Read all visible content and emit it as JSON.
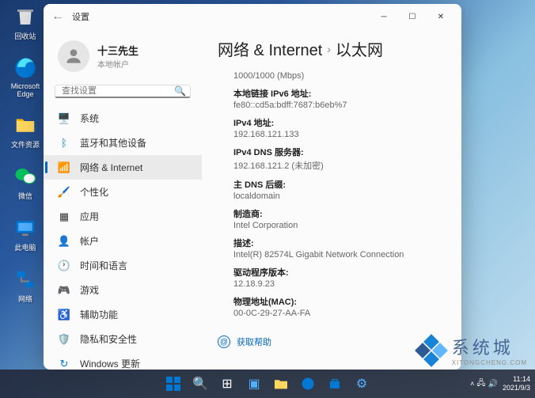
{
  "desktop": {
    "icons": [
      {
        "label": "回收站"
      },
      {
        "label": "Microsoft Edge"
      },
      {
        "label": "文件资源"
      },
      {
        "label": "微信"
      },
      {
        "label": "此电脑"
      },
      {
        "label": "网络"
      }
    ]
  },
  "window": {
    "title": "设置",
    "user": {
      "name": "十三先生",
      "sub": "本地帐户"
    },
    "search_placeholder": "查找设置",
    "nav": [
      {
        "icon": "system",
        "label": "系统"
      },
      {
        "icon": "bluetooth",
        "label": "蓝牙和其他设备"
      },
      {
        "icon": "network",
        "label": "网络 & Internet",
        "active": true
      },
      {
        "icon": "personalize",
        "label": "个性化"
      },
      {
        "icon": "apps",
        "label": "应用"
      },
      {
        "icon": "accounts",
        "label": "帐户"
      },
      {
        "icon": "time",
        "label": "时间和语言"
      },
      {
        "icon": "gaming",
        "label": "游戏"
      },
      {
        "icon": "accessibility",
        "label": "辅助功能"
      },
      {
        "icon": "privacy",
        "label": "隐私和安全性"
      },
      {
        "icon": "update",
        "label": "Windows 更新"
      }
    ],
    "breadcrumb": {
      "parent": "网络 & Internet",
      "current": "以太网"
    },
    "details": [
      {
        "label": "",
        "value": "1000/1000 (Mbps)"
      },
      {
        "label": "本地链接 IPv6 地址:",
        "value": "fe80::cd5a:bdff:7687:b6eb%7"
      },
      {
        "label": "IPv4 地址:",
        "value": "192.168.121.133"
      },
      {
        "label": "IPv4 DNS 服务器:",
        "value": "192.168.121.2 (未加密)"
      },
      {
        "label": "主 DNS 后缀:",
        "value": "localdomain"
      },
      {
        "label": "制造商:",
        "value": "Intel Corporation"
      },
      {
        "label": "描述:",
        "value": "Intel(R) 82574L Gigabit Network Connection"
      },
      {
        "label": "驱动程序版本:",
        "value": "12.18.9.23"
      },
      {
        "label": "物理地址(MAC):",
        "value": "00-0C-29-27-AA-FA"
      }
    ],
    "help": "获取帮助"
  },
  "taskbar": {
    "time": "11:14",
    "date": "2021/9/3"
  },
  "watermark": {
    "cn": "系统城",
    "en": "XITONGCHENG.COM"
  }
}
